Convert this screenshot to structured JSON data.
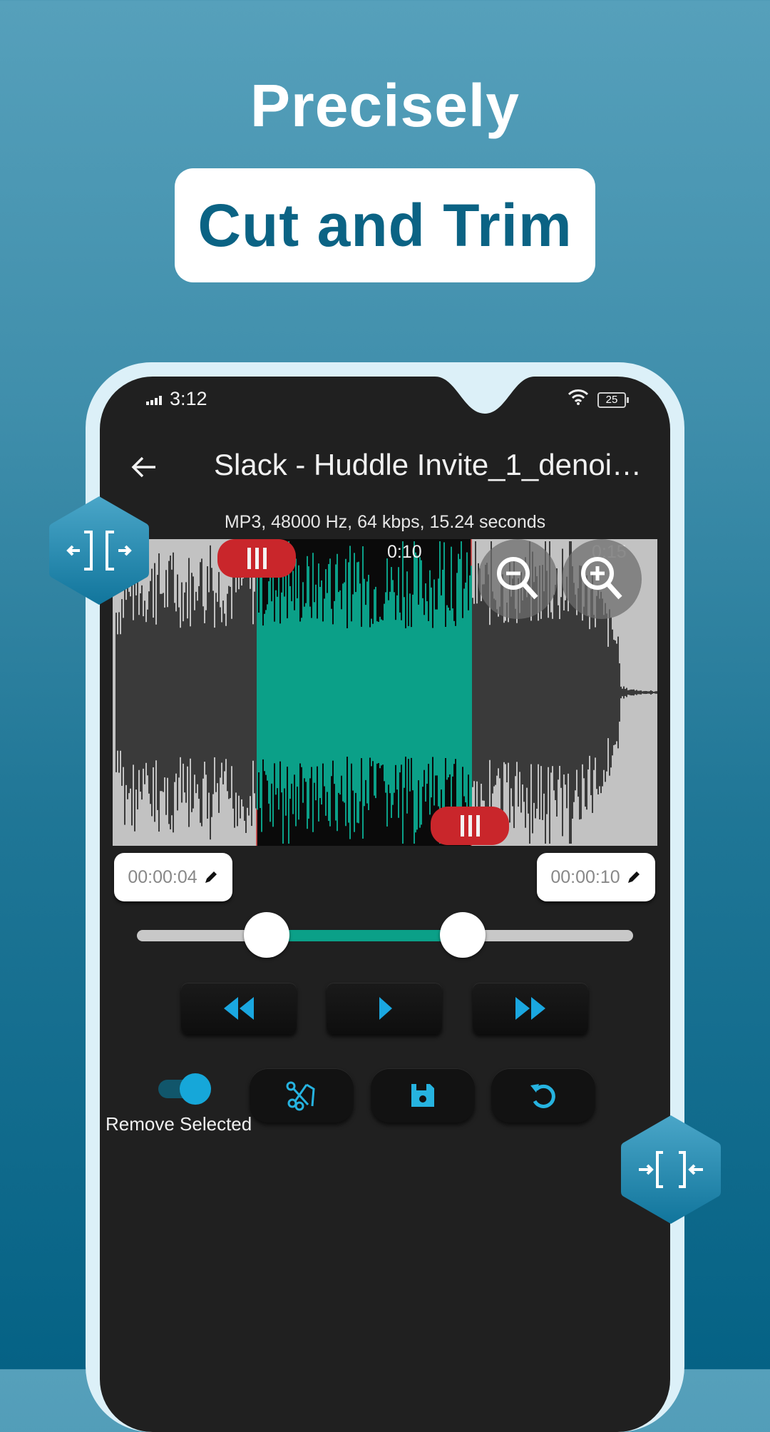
{
  "promo": {
    "headline": "Precisely",
    "badge_text": "Cut and Trim"
  },
  "status_bar": {
    "time": "3:12",
    "battery": "25",
    "icons": [
      "signal-icon",
      "wifi-icon",
      "battery-icon"
    ]
  },
  "header": {
    "back_icon": "arrow-left-icon",
    "title": "Slack - Huddle Invite_1_denoi…"
  },
  "file_info": "MP3, 48000 Hz, 64 kbps, 15.24 seconds",
  "waveform": {
    "time_labels": [
      "0:10",
      "0:15"
    ],
    "duration_seconds": 15.24,
    "selection_start_seconds": 4,
    "selection_end_seconds": 10,
    "zoom_out_icon": "zoom-out-icon",
    "zoom_in_icon": "zoom-in-icon",
    "colors": {
      "selected": "#0ba088",
      "unselected": "#3a3a3a",
      "background": "#c2c2c2",
      "selection_bg": "#0a0a0a",
      "handle": "#c9262b"
    }
  },
  "trim": {
    "start_time": "00:00:04",
    "end_time": "00:00:10",
    "edit_icon": "pencil-icon",
    "range_start_fraction": 0.262,
    "range_end_fraction": 0.656
  },
  "transport": {
    "rewind_icon": "rewind-icon",
    "play_icon": "play-icon",
    "forward_icon": "fast-forward-icon"
  },
  "actions": {
    "toggle_label": "Remove Selected",
    "toggle_on": true,
    "cut_icon": "scissors-icon",
    "save_icon": "save-icon",
    "reset_icon": "undo-icon"
  },
  "badges": {
    "left_icon": "expand-bracket-icon",
    "right_icon": "compress-bracket-icon",
    "accent": "#1b86ad"
  }
}
